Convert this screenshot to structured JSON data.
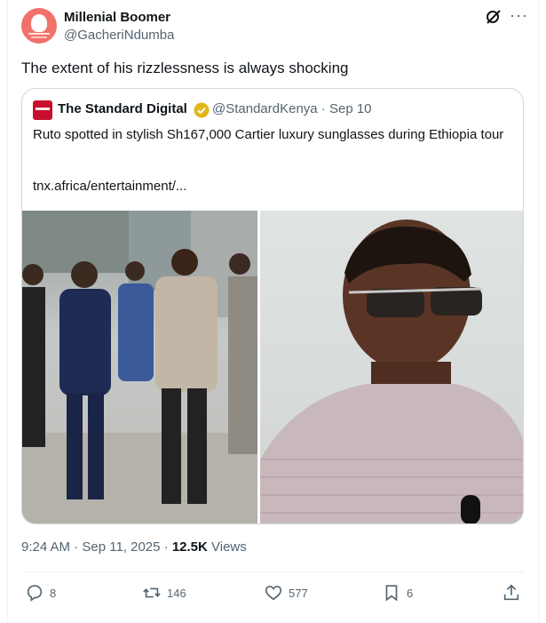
{
  "author": {
    "name": "Millenial Boomer",
    "handle": "@GacheriNdumba"
  },
  "tweet": {
    "text": "The extent of his rizzlessness is always shocking"
  },
  "quote": {
    "name": "The Standard Digital",
    "handle": "@StandardKenya · Sep 10",
    "text": "Ruto spotted in stylish Sh167,000 Cartier luxury sunglasses during Ethiopia tour",
    "link": "tnx.africa/entertainment/..."
  },
  "meta": {
    "time": "9:24 AM · Sep 11, 2025 · ",
    "views_count": "12.5K",
    "views_label": " Views"
  },
  "actions": {
    "replies": "8",
    "reposts": "146",
    "likes": "577",
    "bookmarks": "6"
  },
  "icons": [
    "grok-icon",
    "more-icon",
    "verified-badge-icon",
    "reply-icon",
    "repost-icon",
    "like-icon",
    "bookmark-icon",
    "share-icon"
  ],
  "colors": {
    "text": "#0f1419",
    "secondary": "#536471",
    "border": "#cfd9de",
    "verified_gold": "#e2b719",
    "avatar_bg": "#f0726b"
  }
}
